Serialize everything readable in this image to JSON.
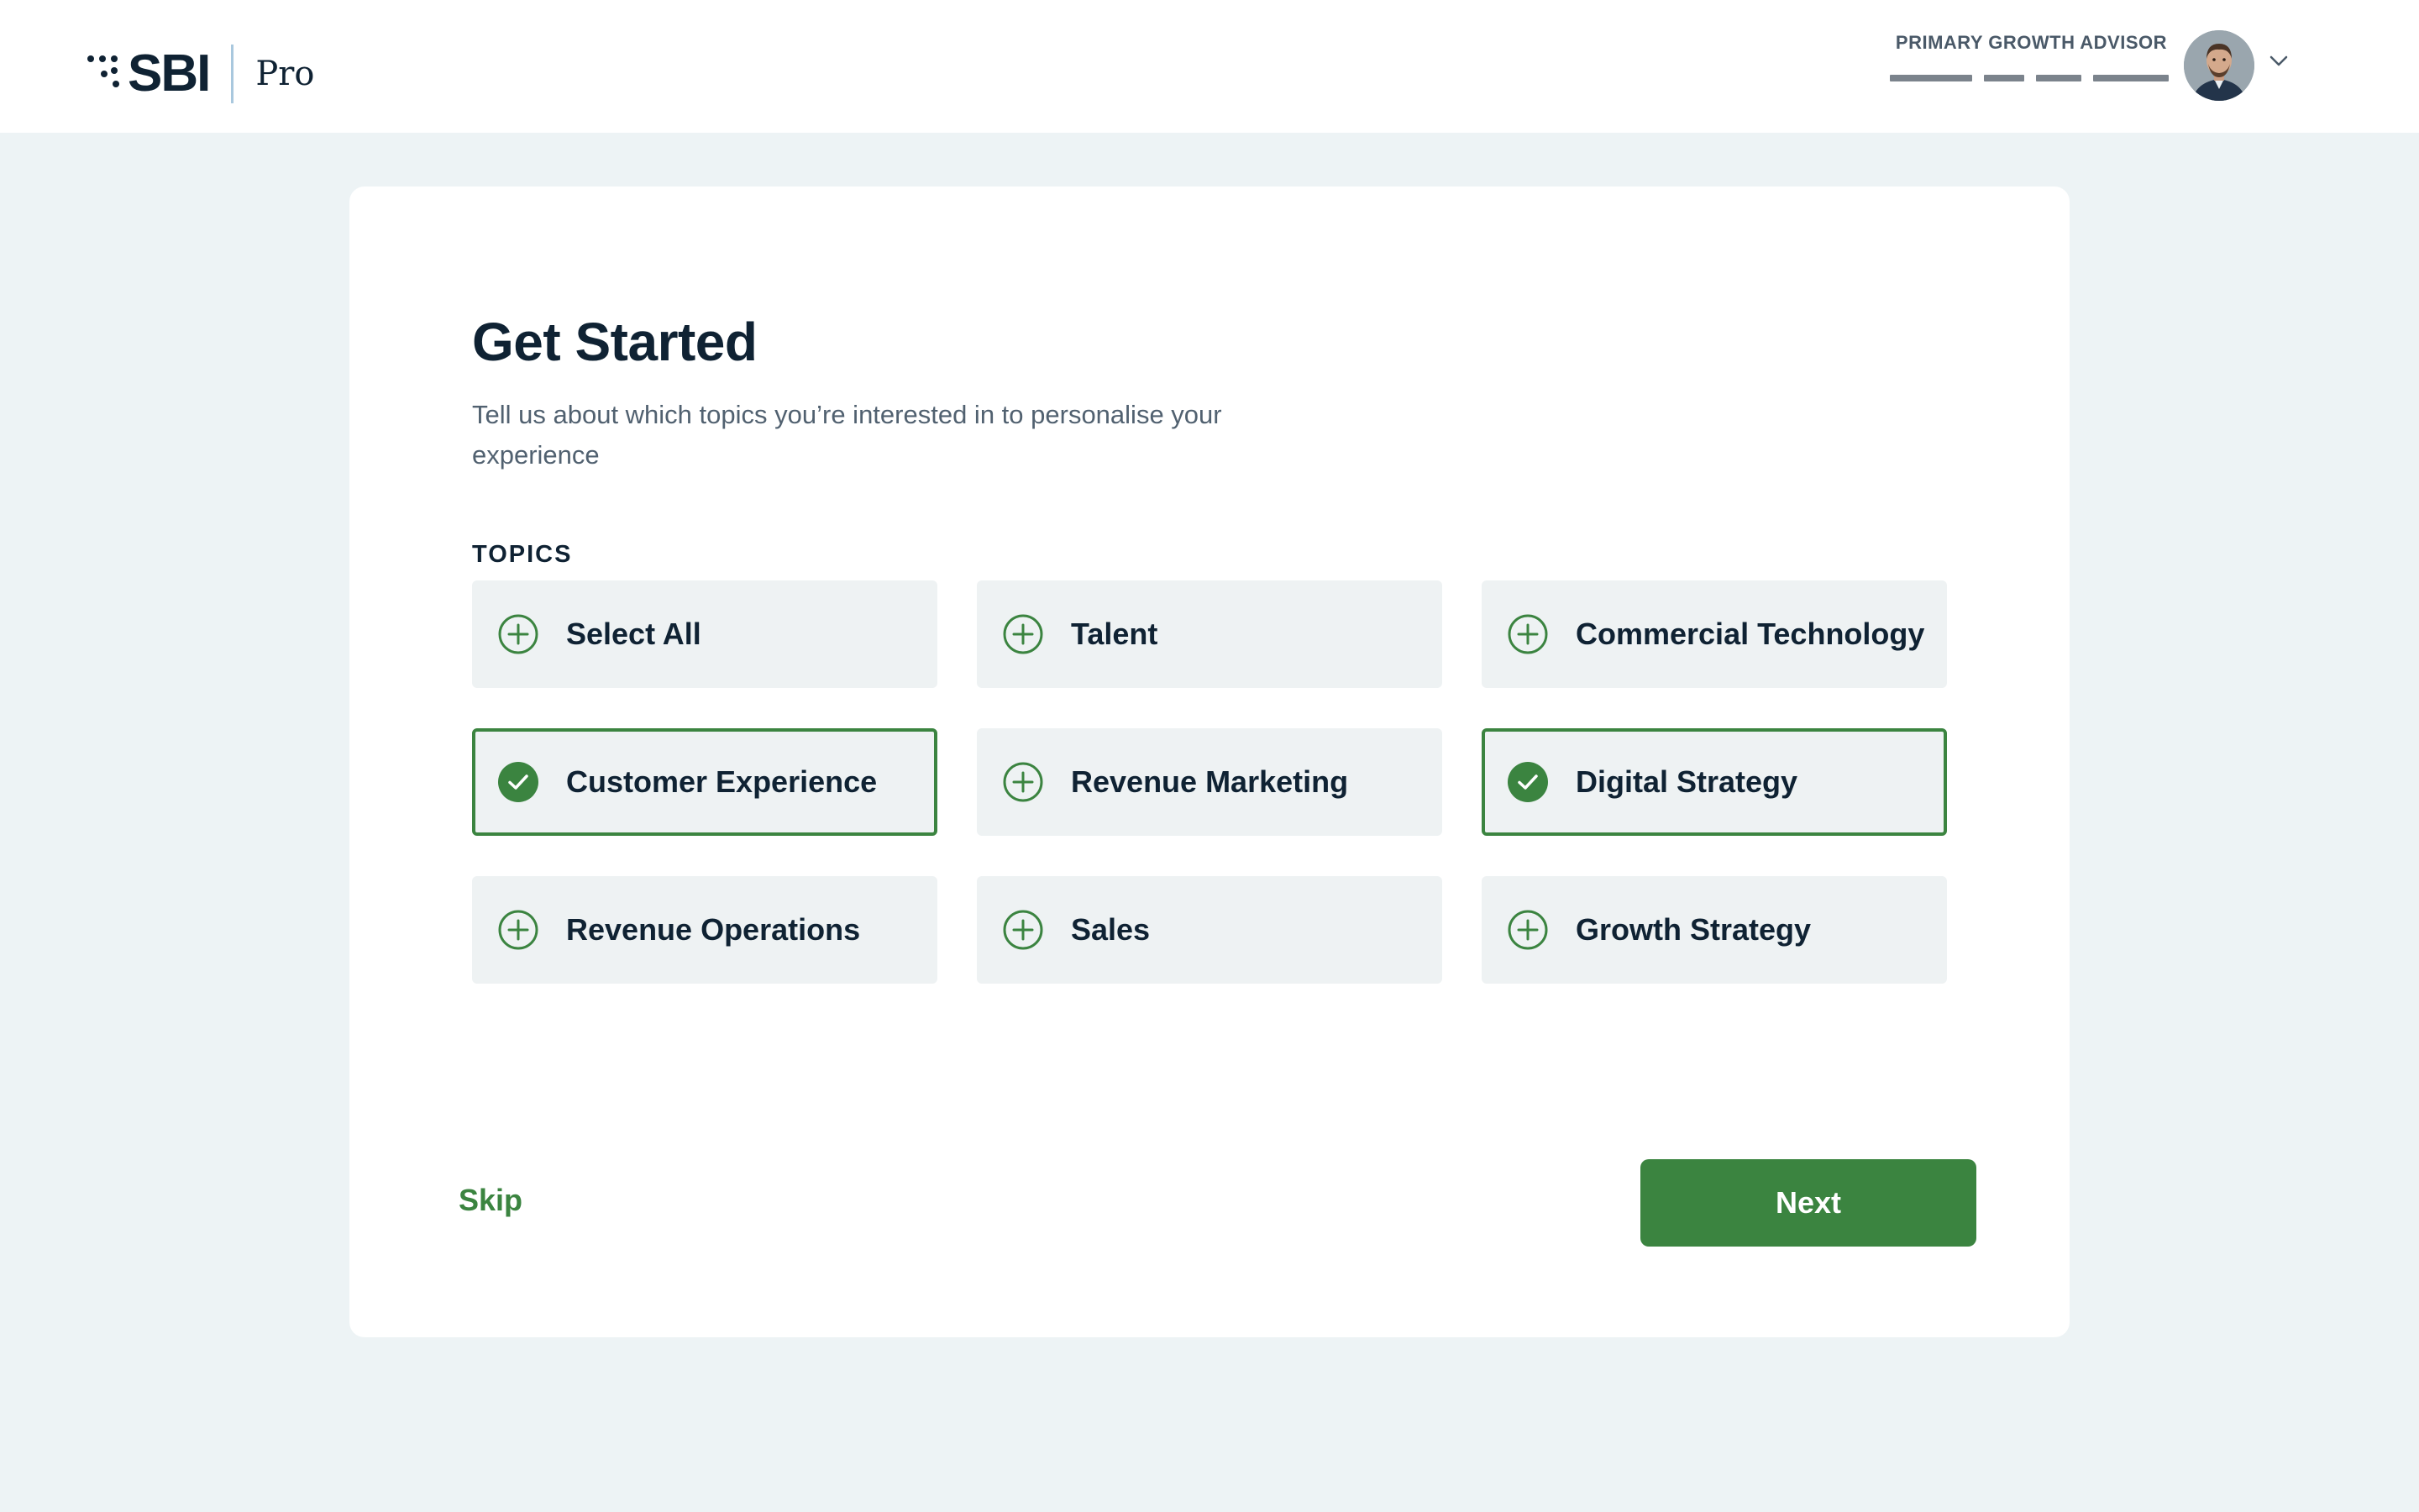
{
  "header": {
    "logo_text": "SBI",
    "product_name": "Pro",
    "advisor_label": "PRIMARY GROWTH ADVISOR",
    "progress": {
      "total_steps": 4,
      "completed_steps": 4
    }
  },
  "onboarding": {
    "title": "Get Started",
    "subtitle": "Tell us about which topics you’re interested in to personalise your experience",
    "section_label": "TOPICS",
    "topics": [
      {
        "label": "Select All",
        "selected": false,
        "icon": "plus-circle-icon"
      },
      {
        "label": "Talent",
        "selected": false,
        "icon": "plus-circle-icon"
      },
      {
        "label": "Commercial Technology",
        "selected": false,
        "icon": "plus-circle-icon"
      },
      {
        "label": "Customer Experience",
        "selected": true,
        "icon": "check-circle-icon"
      },
      {
        "label": "Revenue Marketing",
        "selected": false,
        "icon": "plus-circle-icon"
      },
      {
        "label": "Digital Strategy",
        "selected": true,
        "icon": "check-circle-icon"
      },
      {
        "label": "Revenue Operations",
        "selected": false,
        "icon": "plus-circle-icon"
      },
      {
        "label": "Sales",
        "selected": false,
        "icon": "plus-circle-icon"
      },
      {
        "label": "Growth Strategy",
        "selected": false,
        "icon": "plus-circle-icon"
      }
    ],
    "skip_label": "Skip",
    "next_label": "Next"
  },
  "colors": {
    "accent": "#3b8440",
    "background": "#edf3f5",
    "text_dark": "#0f2233",
    "tile": "#eef2f3"
  }
}
